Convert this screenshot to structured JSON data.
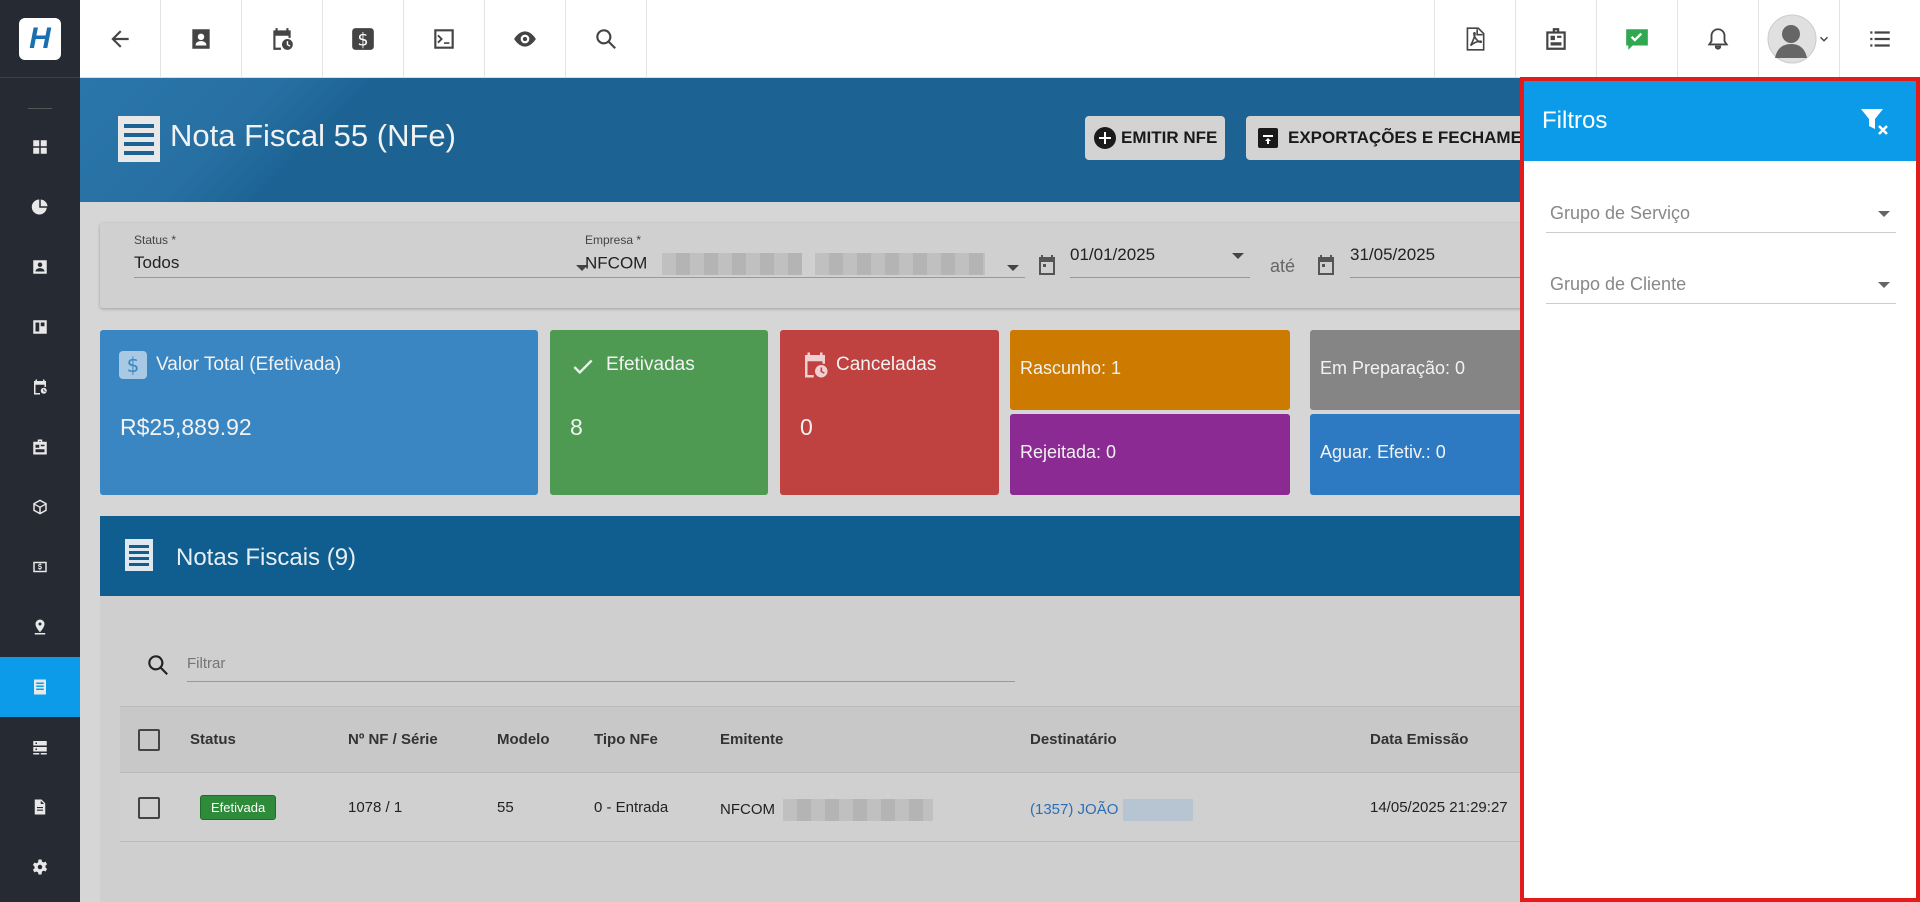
{
  "header": {
    "page_title": "Nota Fiscal 55 (NFe)",
    "emit_label": "EMITIR NFE",
    "export_label": "EXPORTAÇÕES E FECHAMENTOS"
  },
  "filters": {
    "status_label": "Status *",
    "status_value": "Todos",
    "empresa_label": "Empresa *",
    "empresa_value": "NFCOM",
    "date_from": "01/01/2025",
    "date_sep": "até",
    "date_to": "31/05/2025"
  },
  "stats": {
    "total_title": "Valor Total (Efetivada)",
    "total_value": "R$25,889.92",
    "efetivadas_title": "Efetivadas",
    "efetivadas_value": "8",
    "canceladas_title": "Canceladas",
    "canceladas_value": "0",
    "rascunho": "Rascunho: 1",
    "rejeitada": "Rejeitada: 0",
    "em_preparacao": "Em Preparação: 0",
    "aguar_efetiv": "Aguar. Efetiv.: 0"
  },
  "notes": {
    "title": "Notas Fiscais (9)",
    "search_placeholder": "Filtrar",
    "columns": [
      "Status",
      "Nº NF / Série",
      "Modelo",
      "Tipo NFe",
      "Emitente",
      "Destinatário",
      "Data Emissão"
    ],
    "rows": [
      {
        "status": "Efetivada",
        "number": "1078 / 1",
        "modelo": "55",
        "tipo": "0 - Entrada",
        "emitente": "NFCOM",
        "destinatario": "(1357) JOÃO",
        "data": "14/05/2025 21:29:27"
      }
    ]
  },
  "panel": {
    "title": "Filtros",
    "grupo_servico": "Grupo de Serviço",
    "grupo_cliente": "Grupo de Cliente"
  },
  "colors": {
    "sidebar_bg": "#262b33",
    "accent": "#0b9be8",
    "banner": "#1c6394",
    "stat_total": "#3a86c2",
    "stat_efetivadas": "#4f9a52",
    "stat_canceladas": "#c04240",
    "stat_rascunho": "#cc7a00",
    "stat_rejeitada": "#8a2a92",
    "stat_preparacao": "#858585",
    "stat_aguar": "#2d7ac2",
    "panel_border": "#e31b1b"
  }
}
